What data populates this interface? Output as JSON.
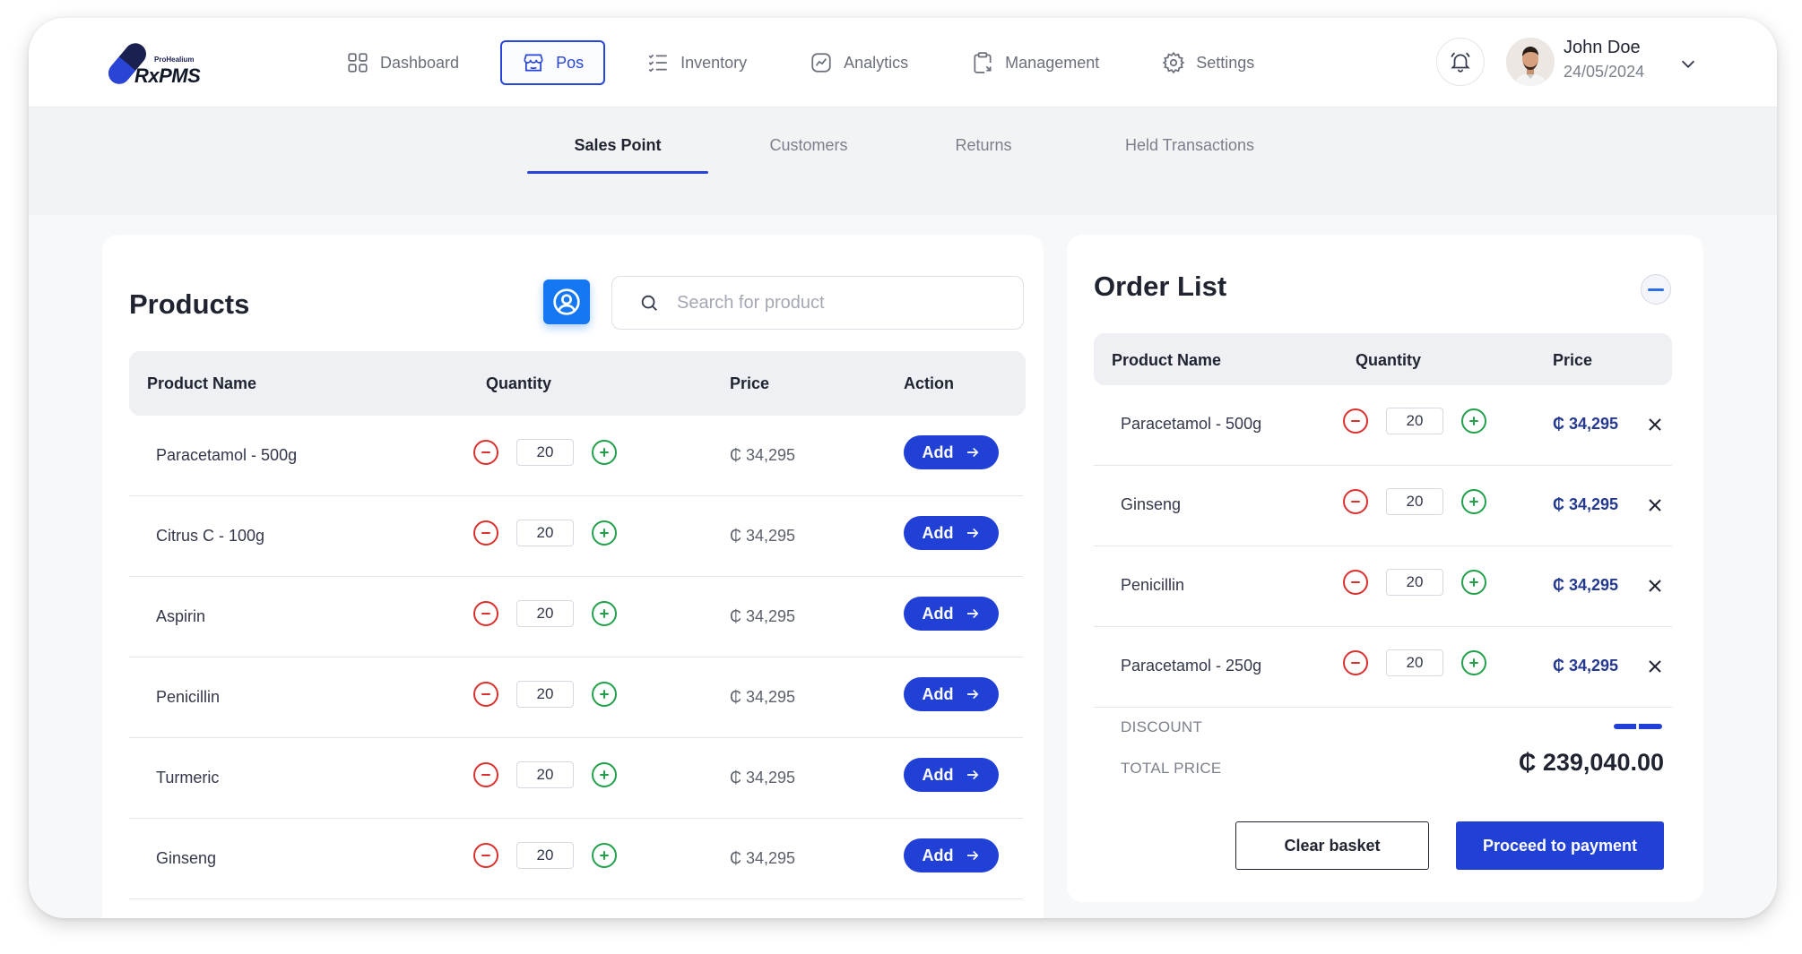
{
  "app": {
    "brand_small": "ProHealium",
    "brand": "RxPMS",
    "logo_mark_text": "Rx PMS"
  },
  "nav": {
    "items": [
      {
        "label": "Dashboard",
        "icon": "grid-icon"
      },
      {
        "label": "Pos",
        "icon": "store-icon",
        "active": true
      },
      {
        "label": "Inventory",
        "icon": "checklist-icon"
      },
      {
        "label": "Analytics",
        "icon": "chart-icon"
      },
      {
        "label": "Management",
        "icon": "clipboard-icon"
      },
      {
        "label": "Settings",
        "icon": "gear-icon"
      }
    ]
  },
  "user": {
    "name": "John Doe",
    "date": "24/05/2024"
  },
  "subtabs": [
    {
      "label": "Sales Point",
      "active": true
    },
    {
      "label": "Customers"
    },
    {
      "label": "Returns"
    },
    {
      "label": "Held Transactions"
    }
  ],
  "products": {
    "title": "Products",
    "search_placeholder": "Search for product",
    "columns": [
      "Product Name",
      "Quantity",
      "Price",
      "Action"
    ],
    "add_label": "Add",
    "rows": [
      {
        "name": "Paracetamol - 500g",
        "qty": "20",
        "price": "₵ 34,295"
      },
      {
        "name": "Citrus C - 100g",
        "qty": "20",
        "price": "₵ 34,295"
      },
      {
        "name": "Aspirin",
        "qty": "20",
        "price": "₵ 34,295"
      },
      {
        "name": "Penicillin",
        "qty": "20",
        "price": "₵ 34,295"
      },
      {
        "name": "Turmeric",
        "qty": "20",
        "price": "₵ 34,295"
      },
      {
        "name": "Ginseng",
        "qty": "20",
        "price": "₵ 34,295"
      }
    ]
  },
  "order": {
    "title": "Order List",
    "columns": [
      "Product Name",
      "Quantity",
      "Price"
    ],
    "rows": [
      {
        "name": "Paracetamol - 500g",
        "qty": "20",
        "price": "₵ 34,295"
      },
      {
        "name": "Ginseng",
        "qty": "20",
        "price": "₵ 34,295"
      },
      {
        "name": "Penicillin",
        "qty": "20",
        "price": "₵ 34,295"
      },
      {
        "name": "Paracetamol - 250g",
        "qty": "20",
        "price": "₵ 34,295"
      }
    ],
    "discount_label": "DISCOUNT",
    "total_label": "TOTAL PRICE",
    "total_value": "₵  239,040.00",
    "clear_label": "Clear basket",
    "pay_label": "Proceed to payment"
  },
  "colors": {
    "accent": "#2140d6",
    "customer_button": "#1577f2",
    "minus": "#d9322e",
    "plus": "#22a04b"
  }
}
